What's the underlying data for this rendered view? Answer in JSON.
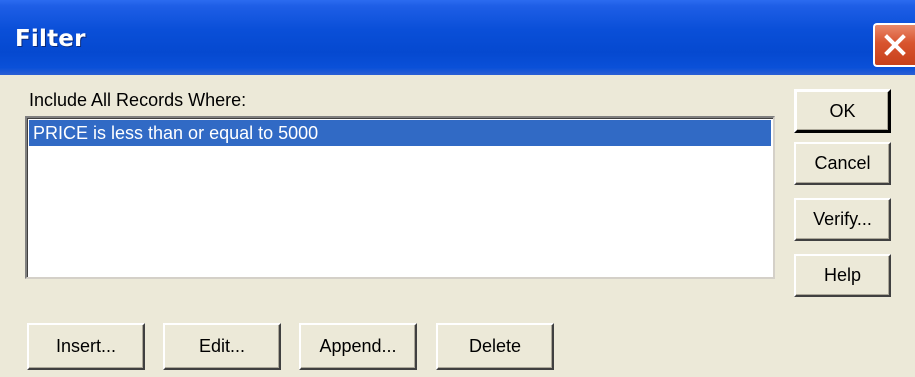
{
  "window": {
    "title": "Filter",
    "close_icon": "close-icon"
  },
  "filter": {
    "label": "Include All Records Where:",
    "conditions": [
      {
        "text": "PRICE is less than or equal to 5000",
        "selected": true
      }
    ]
  },
  "buttons": {
    "ok": "OK",
    "cancel": "Cancel",
    "verify": "Verify...",
    "help": "Help",
    "insert": "Insert...",
    "edit": "Edit...",
    "append": "Append...",
    "delete": "Delete"
  },
  "colors": {
    "titlebar": "#0549d0",
    "selection": "#316ac5",
    "dialog_bg": "#ece9d8",
    "close_button": "#d8542e"
  }
}
